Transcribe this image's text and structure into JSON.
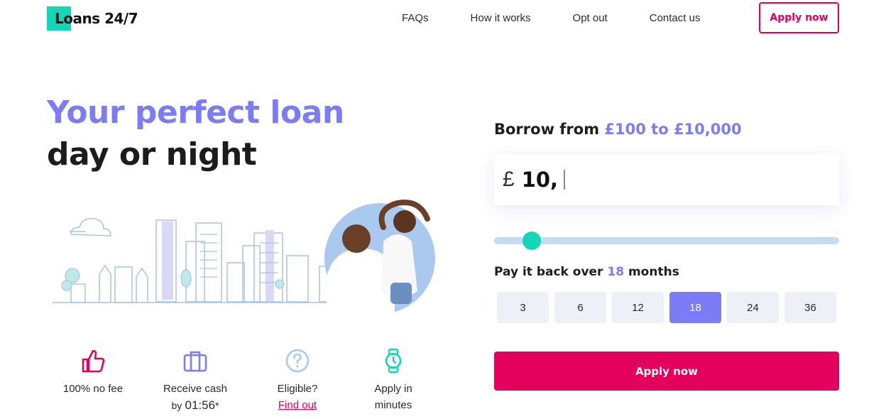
{
  "header": {
    "logo_text": "Loans 24/7",
    "nav": [
      {
        "label": "FAQs"
      },
      {
        "label": "How it works"
      },
      {
        "label": "Opt out"
      },
      {
        "label": "Contact us"
      }
    ],
    "apply_label": "Apply now"
  },
  "hero": {
    "line1": "Your perfect loan",
    "line2": "day or night"
  },
  "features": [
    {
      "icon": "thumbs-up-icon",
      "line1": "100% no fee"
    },
    {
      "icon": "briefcase-icon",
      "line1": "Receive cash",
      "prefix": "by",
      "time": "01:56",
      "suffix": "*"
    },
    {
      "icon": "question-circle-icon",
      "line1": "Eligible?",
      "link": "Find out"
    },
    {
      "icon": "watch-icon",
      "line1": "Apply in",
      "line2": "minutes"
    }
  ],
  "calculator": {
    "borrow_prefix": "Borrow from",
    "borrow_range": "£100 to £10,000",
    "currency": "£",
    "amount": "10,",
    "slider_fraction": 0.11,
    "payback_prefix": "Pay it back over",
    "payback_months": "18",
    "payback_suffix": "months",
    "terms": [
      "3",
      "6",
      "12",
      "18",
      "24",
      "36"
    ],
    "selected_term": "18",
    "apply_label": "Apply now"
  },
  "colors": {
    "accent_pink": "#e4005d",
    "accent_purple": "#7c7cf7",
    "accent_teal": "#14d6b8"
  }
}
